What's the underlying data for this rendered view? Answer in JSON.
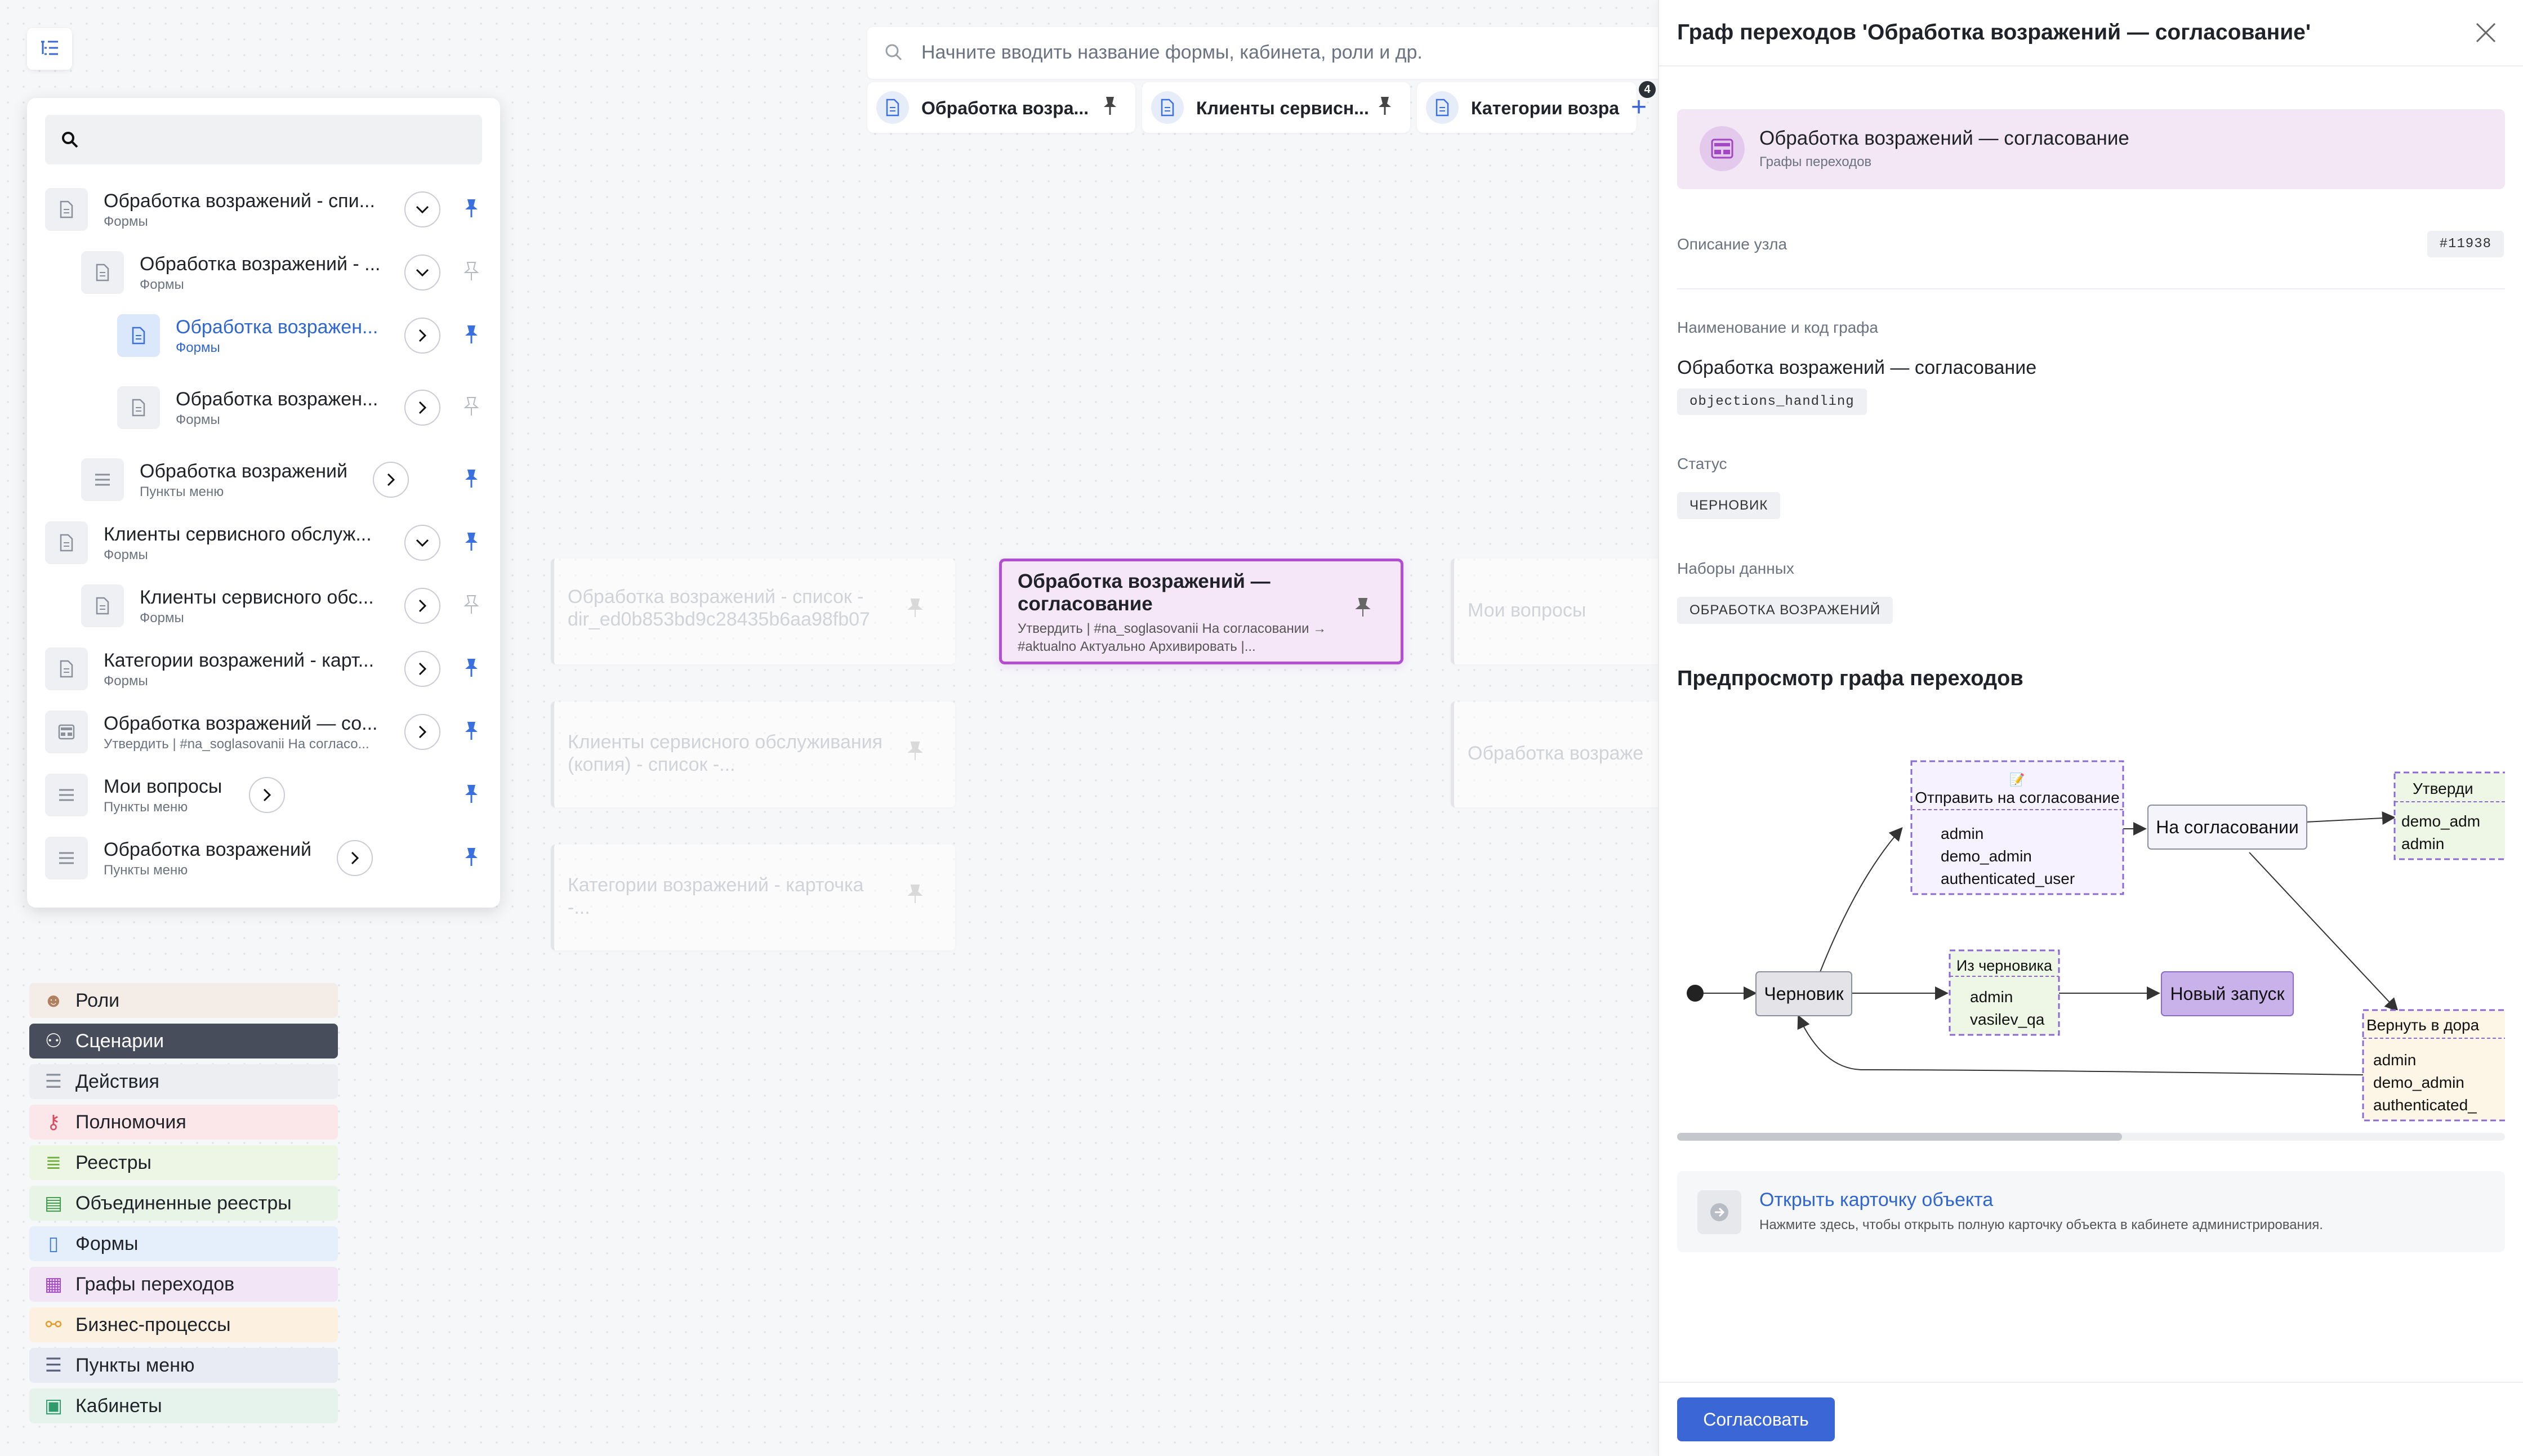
{
  "top_search": {
    "placeholder": "Начните вводить название формы, кабинета, роли и др."
  },
  "tabs": [
    {
      "label": "Обработка возра..."
    },
    {
      "label": "Клиенты сервисн..."
    },
    {
      "label": "Категории возра"
    }
  ],
  "tabs_badge": "4",
  "tree": {
    "items": [
      {
        "title": "Обработка возражений - спи...",
        "subtitle": "Формы"
      },
      {
        "title": "Обработка возражений - ...",
        "subtitle": "Формы"
      },
      {
        "title": "Обработка возражен...",
        "subtitle": "Формы"
      },
      {
        "title": "Обработка возражен...",
        "subtitle": "Формы"
      },
      {
        "title": "Обработка возражений",
        "subtitle": "Пункты меню"
      },
      {
        "title": "Клиенты сервисного обслуж...",
        "subtitle": "Формы"
      },
      {
        "title": "Клиенты сервисного обс...",
        "subtitle": "Формы"
      },
      {
        "title": "Категории возражений - карт...",
        "subtitle": "Формы"
      },
      {
        "title": "Обработка возражений — со...",
        "subtitle": "Утвердить | #na_soglasovanii На согласо..."
      },
      {
        "title": "Мои вопросы",
        "subtitle": "Пункты меню"
      },
      {
        "title": "Обработка возражений",
        "subtitle": "Пункты меню"
      }
    ]
  },
  "categories": [
    {
      "label": "Роли",
      "bg": "#f4ece6",
      "color": "#b08060"
    },
    {
      "label": "Сценарии",
      "bg": "#474d5a",
      "color": "#ffffff"
    },
    {
      "label": "Действия",
      "bg": "#eceef2",
      "color": "#8a909a"
    },
    {
      "label": "Полномочия",
      "bg": "#fbe7ea",
      "color": "#d94c5e"
    },
    {
      "label": "Реестры",
      "bg": "#edf5e4",
      "color": "#6fae3c"
    },
    {
      "label": "Объединенные реестры",
      "bg": "#e8f4e6",
      "color": "#3f9a4a"
    },
    {
      "label": "Формы",
      "bg": "#e5effb",
      "color": "#3f7bd6"
    },
    {
      "label": "Графы переходов",
      "bg": "#f2e6f6",
      "color": "#a447c2"
    },
    {
      "label": "Бизнес-процессы",
      "bg": "#fcf1e0",
      "color": "#e69a2e"
    },
    {
      "label": "Пункты меню",
      "bg": "#e8eaf4",
      "color": "#5a6280"
    },
    {
      "label": "Кабинеты",
      "bg": "#e5f3ec",
      "color": "#2f9b6a"
    }
  ],
  "canvas": {
    "left_nodes": [
      "Обработка возражений - список - dir_ed0b853bd9c28435b6aa98fb07",
      "Клиенты сервисного обслуживания (копия) - список -...",
      "Категории возражений - карточка -..."
    ],
    "main_node": {
      "title": "Обработка возражений — согласование",
      "subtitle": "Утвердить | #na_soglasovanii На согласовании → #aktualno Актуально Архивировать |..."
    },
    "right_nodes": [
      "Мои вопросы",
      "Обработка возраже"
    ]
  },
  "panel": {
    "title": "Граф переходов 'Обработка возражений — согласование'",
    "object_title": "Обработка возражений — согласование",
    "object_type": "Графы переходов",
    "node_desc_label": "Описание узла",
    "node_id": "#11938",
    "name_label": "Наименование и код графа",
    "name_value": "Обработка возражений — согласование",
    "code_value": "objections_handling",
    "status_label": "Статус",
    "status_value": "ЧЕРНОВИК",
    "datasets_label": "Наборы данных",
    "dataset_value": "ОБРАБОТКА ВОЗРАЖЕНИЙ",
    "preview_title": "Предпросмотр графа переходов",
    "open_title": "Открыть карточку объекта",
    "open_sub": "Нажмите здесь, чтобы открыть полную карточку объекта в кабинете администрирования.",
    "approve_label": "Согласовать"
  },
  "graph": {
    "states": {
      "draft": "Черновик",
      "on_approval": "На согласовании",
      "new_launch": "Новый запуск"
    },
    "transitions": {
      "send": {
        "icon": "📝",
        "title": "Отправить на согласование",
        "roles": [
          "admin",
          "demo_admin",
          "authenticated_user"
        ]
      },
      "from_draft": {
        "title": "Из черновика",
        "roles": [
          "admin",
          "vasilev_qa"
        ]
      },
      "approve": {
        "title": "Утверди",
        "roles": [
          "demo_adm",
          "admin"
        ]
      },
      "return": {
        "title": "Вернуть в дора",
        "roles": [
          "admin",
          "demo_admin",
          "authenticated_"
        ]
      }
    }
  }
}
